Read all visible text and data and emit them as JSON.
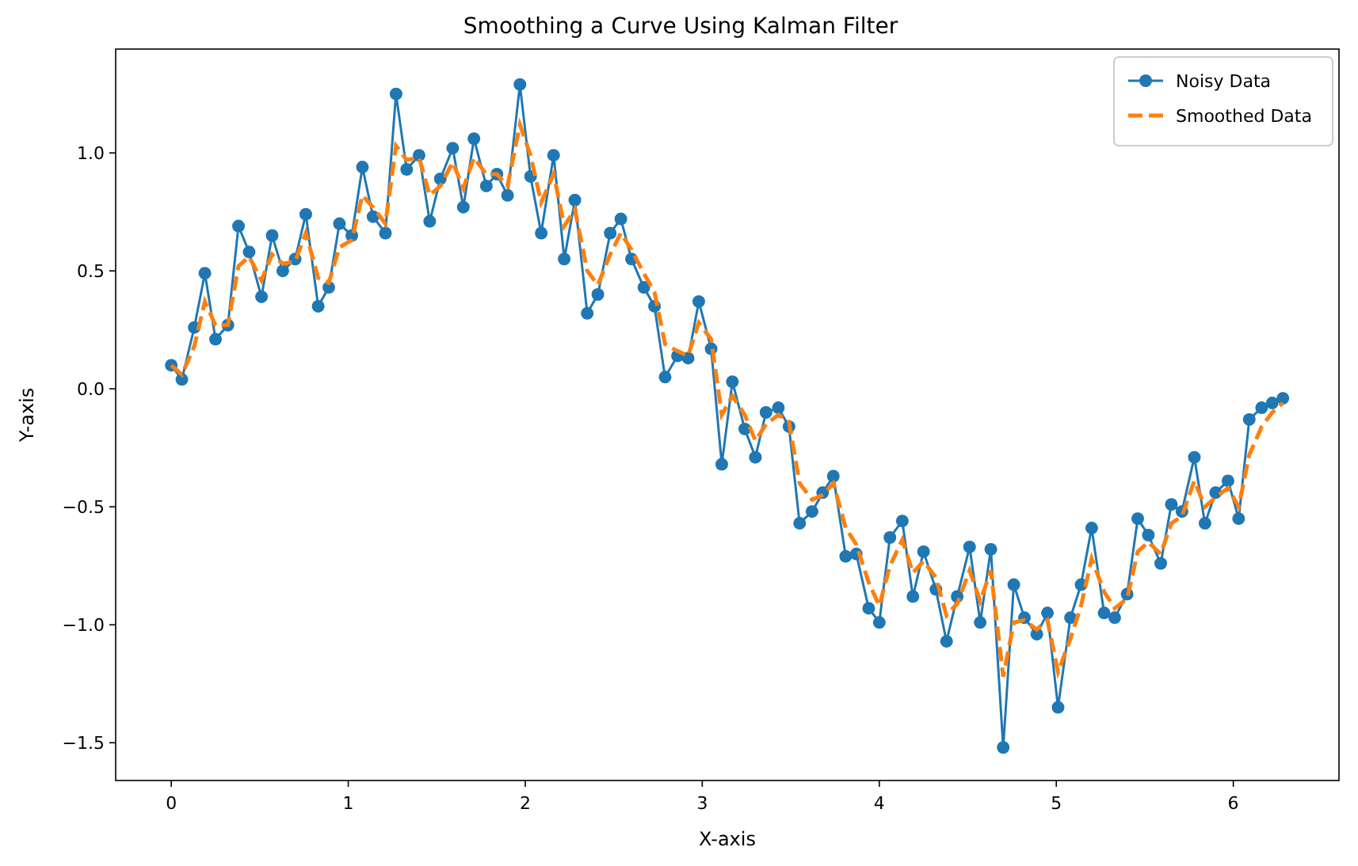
{
  "chart": {
    "chart_data": {
      "type": "line",
      "title": "Smoothing a Curve Using Kalman Filter",
      "xlabel": "X-axis",
      "ylabel": "Y-axis",
      "x": [
        0,
        0.06,
        0.13,
        0.19,
        0.25,
        0.32,
        0.38,
        0.44,
        0.51,
        0.57,
        0.63,
        0.7,
        0.76,
        0.83,
        0.89,
        0.95,
        1.02,
        1.08,
        1.14,
        1.21,
        1.27,
        1.33,
        1.4,
        1.46,
        1.52,
        1.59,
        1.65,
        1.71,
        1.78,
        1.84,
        1.9,
        1.97,
        2.03,
        2.09,
        2.16,
        2.22,
        2.28,
        2.35,
        2.41,
        2.48,
        2.54,
        2.6,
        2.67,
        2.73,
        2.79,
        2.86,
        2.92,
        2.98,
        3.05,
        3.11,
        3.17,
        3.24,
        3.3,
        3.36,
        3.43,
        3.49,
        3.55,
        3.62,
        3.68,
        3.74,
        3.81,
        3.87,
        3.94,
        4.0,
        4.06,
        4.13,
        4.19,
        4.25,
        4.32,
        4.38,
        4.44,
        4.51,
        4.57,
        4.63,
        4.7,
        4.76,
        4.82,
        4.89,
        4.95,
        5.01,
        5.08,
        5.14,
        5.2,
        5.27,
        5.33,
        5.4,
        5.46,
        5.52,
        5.59,
        5.65,
        5.71,
        5.78,
        5.84,
        5.9,
        5.97,
        6.03,
        6.09,
        6.16,
        6.22,
        6.28
      ],
      "series": [
        {
          "name": "Noisy Data",
          "marker": "o",
          "line_style": "solid",
          "color": "#1f77b4",
          "values": [
            0.1,
            0.04,
            0.26,
            0.49,
            0.21,
            0.27,
            0.69,
            0.58,
            0.39,
            0.65,
            0.5,
            0.55,
            0.74,
            0.35,
            0.43,
            0.7,
            0.65,
            0.94,
            0.73,
            0.66,
            1.25,
            0.93,
            0.99,
            0.71,
            0.89,
            1.02,
            0.77,
            1.06,
            0.86,
            0.91,
            0.82,
            1.29,
            0.9,
            0.66,
            0.99,
            0.55,
            0.8,
            0.32,
            0.4,
            0.66,
            0.72,
            0.55,
            0.43,
            0.35,
            0.05,
            0.14,
            0.13,
            0.37,
            0.17,
            -0.32,
            0.03,
            -0.17,
            -0.29,
            -0.1,
            -0.08,
            -0.16,
            -0.57,
            -0.52,
            -0.44,
            -0.37,
            -0.71,
            -0.7,
            -0.93,
            -0.99,
            -0.63,
            -0.56,
            -0.88,
            -0.69,
            -0.85,
            -1.07,
            -0.88,
            -0.67,
            -0.99,
            -0.68,
            -1.52,
            -0.83,
            -0.97,
            -1.04,
            -0.95,
            -1.35,
            -0.97,
            -0.83,
            -0.59,
            -0.95,
            -0.97,
            -0.87,
            -0.55,
            -0.62,
            -0.74,
            -0.49,
            -0.52,
            -0.29,
            -0.57,
            -0.44,
            -0.39,
            -0.55,
            -0.13,
            -0.08,
            -0.06,
            -0.04
          ]
        },
        {
          "name": "Smoothed Data",
          "line_style": "dashed",
          "color": "#ff7f0e",
          "values": [
            0.1,
            0.06,
            0.18,
            0.37,
            0.27,
            0.27,
            0.52,
            0.56,
            0.46,
            0.57,
            0.53,
            0.54,
            0.66,
            0.47,
            0.45,
            0.6,
            0.63,
            0.82,
            0.77,
            0.7,
            1.03,
            0.97,
            0.98,
            0.82,
            0.86,
            0.96,
            0.85,
            0.98,
            0.91,
            0.91,
            0.86,
            1.12,
            0.99,
            0.79,
            0.91,
            0.69,
            0.76,
            0.5,
            0.44,
            0.57,
            0.66,
            0.59,
            0.49,
            0.41,
            0.19,
            0.16,
            0.14,
            0.28,
            0.21,
            -0.11,
            -0.03,
            -0.11,
            -0.22,
            -0.15,
            -0.11,
            -0.14,
            -0.4,
            -0.47,
            -0.45,
            -0.4,
            -0.59,
            -0.66,
            -0.82,
            -0.92,
            -0.75,
            -0.64,
            -0.78,
            -0.73,
            -0.8,
            -0.96,
            -0.91,
            -0.77,
            -0.9,
            -0.77,
            -1.22,
            -0.99,
            -0.98,
            -1.02,
            -0.98,
            -1.2,
            -1.06,
            -0.92,
            -0.72,
            -0.86,
            -0.93,
            -0.89,
            -0.69,
            -0.65,
            -0.7,
            -0.57,
            -0.54,
            -0.39,
            -0.5,
            -0.46,
            -0.42,
            -0.5,
            -0.28,
            -0.16,
            -0.1,
            -0.06
          ]
        }
      ],
      "legend": true,
      "xlim": [
        -0.314,
        6.597
      ],
      "ylim": [
        -1.66,
        1.44
      ],
      "xticks": [
        0,
        1,
        2,
        3,
        4,
        5,
        6
      ],
      "yticks": [
        {
          "value": -1.5,
          "label": "−1.5"
        },
        {
          "value": -1.0,
          "label": "−1.0"
        },
        {
          "value": -0.5,
          "label": "−0.5"
        },
        {
          "value": 0,
          "label": "0.0"
        },
        {
          "value": 0.5,
          "label": "0.5"
        },
        {
          "value": 1.0,
          "label": "1.0"
        }
      ]
    }
  }
}
